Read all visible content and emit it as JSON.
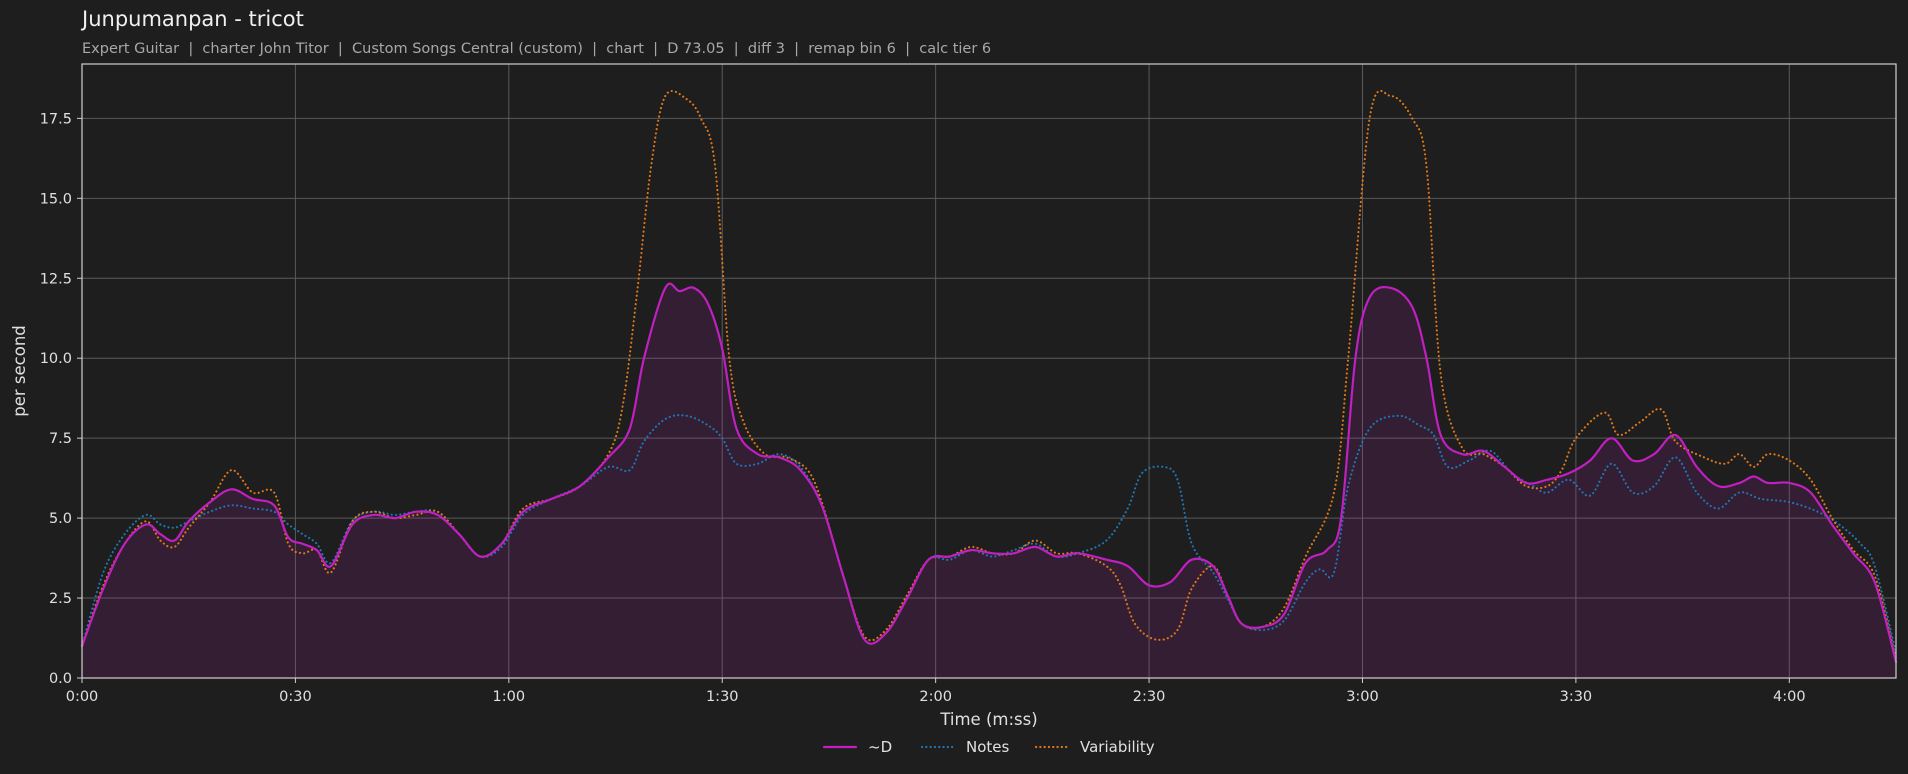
{
  "chart_data": {
    "type": "line",
    "title": "Junpumanpan - tricot",
    "subtitle": "Expert Guitar  |  charter John Titor  |  Custom Songs Central (custom)  |  chart  |  D 73.05  |  diff 3  |  remap bin 6  |  calc tier 6",
    "xlabel": "Time (m:ss)",
    "ylabel": "per second",
    "x_unit": "seconds",
    "xlim": [
      0,
      255
    ],
    "ylim": [
      0,
      19.2
    ],
    "x_ticks": [
      0,
      30,
      60,
      90,
      120,
      150,
      180,
      210,
      240
    ],
    "x_tick_labels": [
      "0:00",
      "0:30",
      "1:00",
      "1:30",
      "2:00",
      "2:30",
      "3:00",
      "3:30",
      "4:00"
    ],
    "y_ticks": [
      0,
      2.5,
      5,
      7.5,
      10,
      12.5,
      15,
      17.5
    ],
    "y_tick_labels": [
      "0.0",
      "2.5",
      "5.0",
      "7.5",
      "10.0",
      "12.5",
      "15.0",
      "17.5"
    ],
    "grid": true,
    "legend_position": "bottom-center",
    "background": "#1e1e1e",
    "series": [
      {
        "name": "~D",
        "color": "#c020c0",
        "style": "solid",
        "fill": true,
        "points": [
          [
            0,
            1.0
          ],
          [
            3,
            2.8
          ],
          [
            6,
            4.2
          ],
          [
            9,
            4.8
          ],
          [
            11,
            4.5
          ],
          [
            13,
            4.3
          ],
          [
            15,
            4.9
          ],
          [
            18,
            5.5
          ],
          [
            21,
            5.9
          ],
          [
            24,
            5.6
          ],
          [
            27,
            5.4
          ],
          [
            29,
            4.4
          ],
          [
            31,
            4.2
          ],
          [
            33,
            4.0
          ],
          [
            35,
            3.5
          ],
          [
            38,
            4.8
          ],
          [
            41,
            5.1
          ],
          [
            44,
            5.0
          ],
          [
            47,
            5.2
          ],
          [
            50,
            5.1
          ],
          [
            53,
            4.5
          ],
          [
            56,
            3.8
          ],
          [
            59,
            4.2
          ],
          [
            62,
            5.2
          ],
          [
            66,
            5.6
          ],
          [
            70,
            6.0
          ],
          [
            74,
            6.9
          ],
          [
            77,
            7.8
          ],
          [
            79,
            10.0
          ],
          [
            82,
            12.2
          ],
          [
            84,
            12.1
          ],
          [
            86,
            12.2
          ],
          [
            88,
            11.7
          ],
          [
            90,
            10.3
          ],
          [
            92,
            7.8
          ],
          [
            95,
            7.0
          ],
          [
            98,
            6.9
          ],
          [
            101,
            6.5
          ],
          [
            104,
            5.4
          ],
          [
            107,
            3.2
          ],
          [
            110,
            1.2
          ],
          [
            113,
            1.4
          ],
          [
            116,
            2.5
          ],
          [
            119,
            3.7
          ],
          [
            122,
            3.8
          ],
          [
            125,
            4.0
          ],
          [
            128,
            3.9
          ],
          [
            131,
            3.9
          ],
          [
            134,
            4.1
          ],
          [
            137,
            3.8
          ],
          [
            140,
            3.9
          ],
          [
            144,
            3.7
          ],
          [
            147,
            3.5
          ],
          [
            150,
            2.9
          ],
          [
            153,
            3.0
          ],
          [
            156,
            3.7
          ],
          [
            159,
            3.5
          ],
          [
            161,
            2.6
          ],
          [
            163,
            1.7
          ],
          [
            166,
            1.6
          ],
          [
            169,
            2.0
          ],
          [
            172,
            3.6
          ],
          [
            175,
            4.0
          ],
          [
            177,
            5.0
          ],
          [
            179,
            10.0
          ],
          [
            181,
            11.9
          ],
          [
            184,
            12.2
          ],
          [
            187,
            11.6
          ],
          [
            189,
            10.0
          ],
          [
            191,
            7.6
          ],
          [
            194,
            7.0
          ],
          [
            197,
            7.1
          ],
          [
            200,
            6.6
          ],
          [
            203,
            6.1
          ],
          [
            206,
            6.2
          ],
          [
            209,
            6.4
          ],
          [
            212,
            6.8
          ],
          [
            215,
            7.5
          ],
          [
            218,
            6.8
          ],
          [
            221,
            7.0
          ],
          [
            224,
            7.6
          ],
          [
            227,
            6.6
          ],
          [
            230,
            6.0
          ],
          [
            233,
            6.1
          ],
          [
            235,
            6.3
          ],
          [
            237,
            6.1
          ],
          [
            240,
            6.1
          ],
          [
            243,
            5.8
          ],
          [
            246,
            4.8
          ],
          [
            249,
            3.9
          ],
          [
            252,
            3.0
          ],
          [
            255,
            0.5
          ]
        ]
      },
      {
        "name": "Notes",
        "color": "#1f77b4",
        "style": "dotted",
        "fill": false,
        "points": [
          [
            0,
            1.0
          ],
          [
            3,
            3.3
          ],
          [
            6,
            4.5
          ],
          [
            9,
            5.1
          ],
          [
            11,
            4.8
          ],
          [
            13,
            4.7
          ],
          [
            15,
            4.9
          ],
          [
            18,
            5.2
          ],
          [
            21,
            5.4
          ],
          [
            24,
            5.3
          ],
          [
            27,
            5.2
          ],
          [
            29,
            4.8
          ],
          [
            31,
            4.5
          ],
          [
            33,
            4.2
          ],
          [
            35,
            3.6
          ],
          [
            38,
            4.9
          ],
          [
            41,
            5.2
          ],
          [
            44,
            5.1
          ],
          [
            47,
            5.2
          ],
          [
            50,
            5.2
          ],
          [
            53,
            4.5
          ],
          [
            56,
            3.8
          ],
          [
            59,
            4.1
          ],
          [
            62,
            5.1
          ],
          [
            66,
            5.6
          ],
          [
            70,
            6.0
          ],
          [
            74,
            6.6
          ],
          [
            77,
            6.5
          ],
          [
            79,
            7.4
          ],
          [
            82,
            8.1
          ],
          [
            85,
            8.2
          ],
          [
            88,
            7.9
          ],
          [
            90,
            7.5
          ],
          [
            92,
            6.7
          ],
          [
            95,
            6.7
          ],
          [
            98,
            7.0
          ],
          [
            101,
            6.6
          ],
          [
            104,
            5.4
          ],
          [
            107,
            3.2
          ],
          [
            110,
            1.2
          ],
          [
            113,
            1.4
          ],
          [
            116,
            2.5
          ],
          [
            119,
            3.7
          ],
          [
            122,
            3.7
          ],
          [
            125,
            4.0
          ],
          [
            128,
            3.8
          ],
          [
            131,
            4.0
          ],
          [
            134,
            4.2
          ],
          [
            137,
            3.8
          ],
          [
            140,
            3.9
          ],
          [
            144,
            4.3
          ],
          [
            147,
            5.3
          ],
          [
            149,
            6.4
          ],
          [
            152,
            6.6
          ],
          [
            154,
            6.2
          ],
          [
            156,
            4.2
          ],
          [
            159,
            3.3
          ],
          [
            161,
            2.5
          ],
          [
            163,
            1.7
          ],
          [
            166,
            1.5
          ],
          [
            169,
            1.8
          ],
          [
            172,
            3.0
          ],
          [
            174,
            3.4
          ],
          [
            176,
            3.3
          ],
          [
            178,
            6.0
          ],
          [
            181,
            7.8
          ],
          [
            185,
            8.2
          ],
          [
            188,
            7.9
          ],
          [
            190,
            7.6
          ],
          [
            192,
            6.6
          ],
          [
            195,
            6.8
          ],
          [
            198,
            7.1
          ],
          [
            201,
            6.4
          ],
          [
            204,
            6.0
          ],
          [
            206,
            5.8
          ],
          [
            209,
            6.2
          ],
          [
            212,
            5.7
          ],
          [
            215,
            6.7
          ],
          [
            218,
            5.8
          ],
          [
            221,
            6.0
          ],
          [
            224,
            6.9
          ],
          [
            227,
            5.8
          ],
          [
            230,
            5.3
          ],
          [
            233,
            5.8
          ],
          [
            236,
            5.6
          ],
          [
            240,
            5.5
          ],
          [
            244,
            5.2
          ],
          [
            247,
            4.8
          ],
          [
            250,
            4.2
          ],
          [
            252,
            3.5
          ],
          [
            255,
            0.8
          ]
        ]
      },
      {
        "name": "Variability",
        "color": "#e07818",
        "style": "dotted",
        "fill": false,
        "points": [
          [
            0,
            1.0
          ],
          [
            3,
            2.9
          ],
          [
            6,
            4.2
          ],
          [
            9,
            4.9
          ],
          [
            11,
            4.3
          ],
          [
            13,
            4.1
          ],
          [
            15,
            4.7
          ],
          [
            18,
            5.5
          ],
          [
            21,
            6.5
          ],
          [
            24,
            5.8
          ],
          [
            27,
            5.8
          ],
          [
            29,
            4.2
          ],
          [
            31,
            3.9
          ],
          [
            33,
            4.0
          ],
          [
            35,
            3.3
          ],
          [
            38,
            4.9
          ],
          [
            41,
            5.2
          ],
          [
            44,
            5.0
          ],
          [
            47,
            5.1
          ],
          [
            50,
            5.2
          ],
          [
            53,
            4.5
          ],
          [
            56,
            3.8
          ],
          [
            59,
            4.2
          ],
          [
            62,
            5.3
          ],
          [
            66,
            5.6
          ],
          [
            70,
            6.0
          ],
          [
            74,
            7.0
          ],
          [
            76,
            8.5
          ],
          [
            78,
            12.0
          ],
          [
            80,
            16.0
          ],
          [
            82,
            18.2
          ],
          [
            85,
            18.1
          ],
          [
            87,
            17.5
          ],
          [
            89,
            16.0
          ],
          [
            91,
            10.0
          ],
          [
            93,
            8.0
          ],
          [
            96,
            7.0
          ],
          [
            99,
            6.9
          ],
          [
            102,
            6.5
          ],
          [
            104,
            5.5
          ],
          [
            107,
            3.2
          ],
          [
            110,
            1.3
          ],
          [
            113,
            1.5
          ],
          [
            116,
            2.6
          ],
          [
            119,
            3.7
          ],
          [
            122,
            3.8
          ],
          [
            125,
            4.1
          ],
          [
            128,
            3.9
          ],
          [
            131,
            3.9
          ],
          [
            134,
            4.3
          ],
          [
            137,
            3.9
          ],
          [
            140,
            3.9
          ],
          [
            144,
            3.5
          ],
          [
            146,
            2.9
          ],
          [
            148,
            1.7
          ],
          [
            151,
            1.2
          ],
          [
            154,
            1.5
          ],
          [
            156,
            2.8
          ],
          [
            159,
            3.5
          ],
          [
            161,
            2.6
          ],
          [
            163,
            1.7
          ],
          [
            166,
            1.6
          ],
          [
            169,
            2.2
          ],
          [
            172,
            3.8
          ],
          [
            176,
            5.8
          ],
          [
            178,
            10.0
          ],
          [
            181,
            17.5
          ],
          [
            184,
            18.2
          ],
          [
            187,
            17.5
          ],
          [
            189,
            16.0
          ],
          [
            191,
            9.5
          ],
          [
            194,
            7.2
          ],
          [
            197,
            7.0
          ],
          [
            200,
            6.6
          ],
          [
            203,
            6.0
          ],
          [
            206,
            6.0
          ],
          [
            208,
            6.5
          ],
          [
            210,
            7.5
          ],
          [
            214,
            8.3
          ],
          [
            216,
            7.6
          ],
          [
            219,
            8.0
          ],
          [
            222,
            8.4
          ],
          [
            224,
            7.4
          ],
          [
            228,
            6.9
          ],
          [
            231,
            6.7
          ],
          [
            233,
            7.0
          ],
          [
            235,
            6.6
          ],
          [
            237,
            7.0
          ],
          [
            240,
            6.8
          ],
          [
            243,
            6.2
          ],
          [
            246,
            5.0
          ],
          [
            249,
            4.0
          ],
          [
            252,
            3.2
          ],
          [
            255,
            0.6
          ]
        ]
      }
    ]
  }
}
